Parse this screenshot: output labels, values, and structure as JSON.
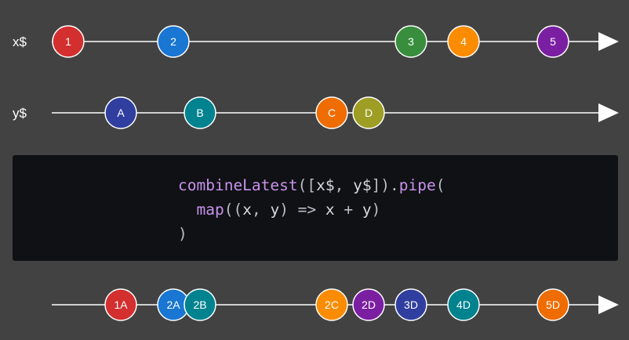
{
  "colors": {
    "background": "#424242",
    "line": "#ffffff",
    "code_background": "#0f1115",
    "code_function": "#c792ea",
    "code_punctuation": "#b9bdc6",
    "code_text": "#d6d9e0"
  },
  "streams": [
    {
      "id": "x",
      "label": "x$",
      "marbles": [
        {
          "label": "1",
          "color": "#d32f2f"
        },
        {
          "label": "2",
          "color": "#1976d2"
        },
        {
          "label": "3",
          "color": "#388e3c"
        },
        {
          "label": "4",
          "color": "#fb8c00"
        },
        {
          "label": "5",
          "color": "#7b1fa2"
        }
      ]
    },
    {
      "id": "y",
      "label": "y$",
      "marbles": [
        {
          "label": "A",
          "color": "#303f9f"
        },
        {
          "label": "B",
          "color": "#00838f"
        },
        {
          "label": "C",
          "color": "#ef6c00"
        },
        {
          "label": "D",
          "color": "#9e9d24"
        }
      ]
    },
    {
      "id": "result",
      "label": "",
      "marbles": [
        {
          "label": "1A",
          "color": "#d32f2f"
        },
        {
          "label": "2A",
          "color": "#1976d2"
        },
        {
          "label": "2B",
          "color": "#00838f"
        },
        {
          "label": "2C",
          "color": "#fb8c00"
        },
        {
          "label": "2D",
          "color": "#7b1fa2"
        },
        {
          "label": "3D",
          "color": "#303f9f"
        },
        {
          "label": "4D",
          "color": "#00838f"
        },
        {
          "label": "5D",
          "color": "#ef6c00"
        }
      ]
    }
  ],
  "code": {
    "lines": [
      [
        {
          "t": "combineLatest",
          "k": "fn"
        },
        {
          "t": "([",
          "k": "punct"
        },
        {
          "t": "x$",
          "k": "var"
        },
        {
          "t": ", ",
          "k": "punct"
        },
        {
          "t": "y$",
          "k": "var"
        },
        {
          "t": "]).",
          "k": "punct"
        },
        {
          "t": "pipe",
          "k": "fn"
        },
        {
          "t": "(",
          "k": "punct"
        }
      ],
      [
        {
          "t": "  ",
          "k": "var"
        },
        {
          "t": "map",
          "k": "fn"
        },
        {
          "t": "((",
          "k": "punct"
        },
        {
          "t": "x",
          "k": "var"
        },
        {
          "t": ", ",
          "k": "punct"
        },
        {
          "t": "y",
          "k": "var"
        },
        {
          "t": ") => ",
          "k": "punct"
        },
        {
          "t": "x",
          "k": "var"
        },
        {
          "t": " + ",
          "k": "punct"
        },
        {
          "t": "y",
          "k": "var"
        },
        {
          "t": ")",
          "k": "punct"
        }
      ],
      [
        {
          "t": ")",
          "k": "punct"
        }
      ]
    ]
  }
}
